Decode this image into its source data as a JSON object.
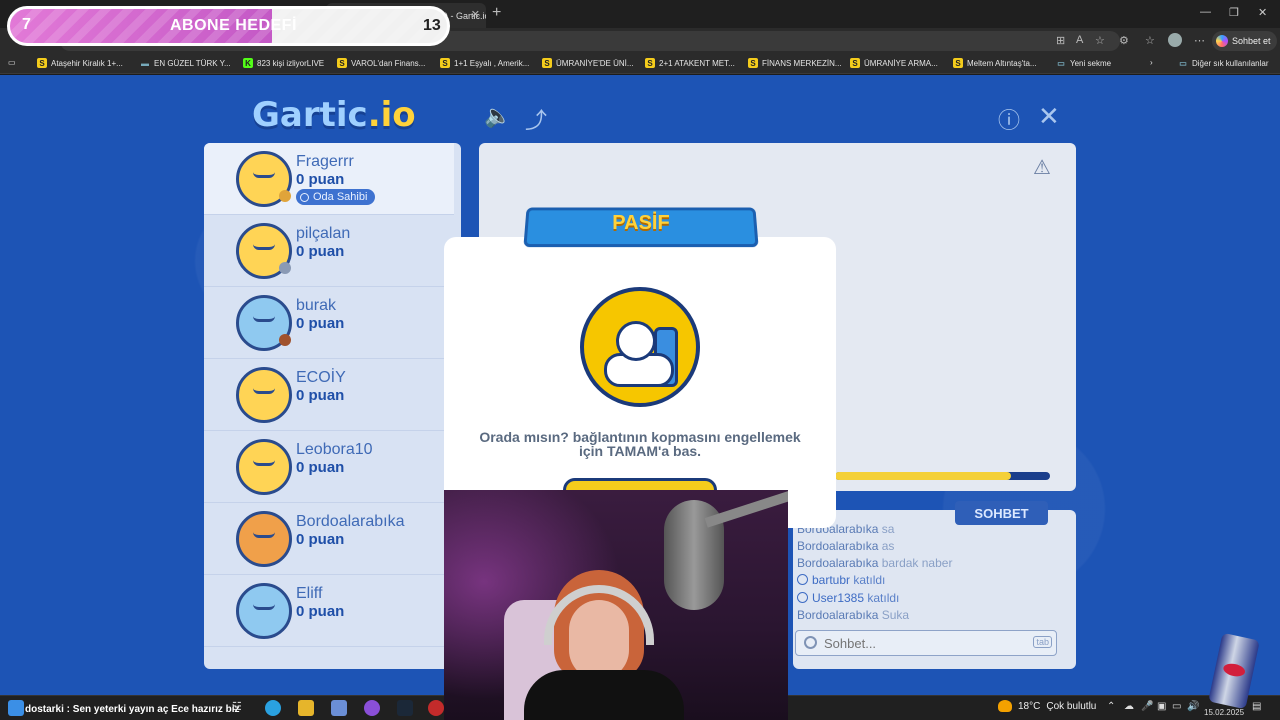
{
  "browser": {
    "tab_title": "Genel #5Ov2pQ (Türkçe) - Gartic.io",
    "sohbet_et": "Sohbet et",
    "bookmarks": [
      {
        "label": "Ataşehir Kiralık 1+...",
        "icon": "S"
      },
      {
        "label": "EN GÜZEL TÜRK Y...",
        "icon": "flag"
      },
      {
        "label": "823 kişi izliyorLIVE",
        "icon": "K"
      },
      {
        "label": "VAROL'dan Finans...",
        "icon": "S"
      },
      {
        "label": "1+1 Eşyalı , Amerik...",
        "icon": "S"
      },
      {
        "label": "ÜMRANİYE'DE ÜNİ...",
        "icon": "S"
      },
      {
        "label": "2+1 ATAKENT MET...",
        "icon": "S"
      },
      {
        "label": "FİNANS MERKEZİN...",
        "icon": "S"
      },
      {
        "label": "ÜMRANİYE ARMA...",
        "icon": "S"
      },
      {
        "label": "Meltem Altıntaş'ta...",
        "icon": "S"
      },
      {
        "label": "Yeni sekme",
        "icon": "page"
      }
    ],
    "other_bookmarks": "Diğer sık kullanılanlar"
  },
  "goal": {
    "current": "7",
    "title": "ABONE HEDEFİ",
    "target": "13",
    "progress_fraction": 0.538
  },
  "game": {
    "logo_main": "Gartic",
    "logo_suffix": ".io",
    "players": [
      {
        "name": "Fragerrr",
        "score": "0 puan",
        "owner_badge": "Oda Sahibi"
      },
      {
        "name": "pilçalan",
        "score": "0 puan"
      },
      {
        "name": "burak",
        "score": "0 puan"
      },
      {
        "name": "ECOİY",
        "score": "0 puan"
      },
      {
        "name": "Leobora10",
        "score": "0 puan"
      },
      {
        "name": "Bordoalarabıka",
        "score": "0 puan"
      },
      {
        "name": "Eliff",
        "score": "0 puan"
      }
    ],
    "timer_fraction": 0.82,
    "chat": {
      "tab_label": "SOHBET",
      "messages": [
        {
          "user": "Bordoalarabıka",
          "text": "sa"
        },
        {
          "user": "Bordoalarabıka",
          "text": "as"
        },
        {
          "user": "Bordoalarabıka",
          "text": "bardak naber"
        },
        {
          "join_user": "bartubr",
          "join_text": "katıldı"
        },
        {
          "join_user": "User1385",
          "join_text": "katıldı"
        },
        {
          "user": "Bordoalarabıka",
          "text": "Suka"
        }
      ],
      "input_placeholder": "Sohbet...",
      "tab_hint": "tab"
    }
  },
  "modal": {
    "title": "PASİF",
    "message": "Orada mısın? bağlantının kopmasını engellemek için TAMAM'a bas."
  },
  "taskbar": {
    "ticker_user": "dostarki",
    "ticker_text": " : Sen yeterki yayın aç Ece hazırız biz",
    "weather_temp": "18°C",
    "weather_desc": "Çok bulutlu",
    "date": "15.02.2025"
  },
  "colors": {
    "game_bg": "#1d54b5",
    "accent_yellow": "#f4cc1c",
    "goal_pink": "#e279d7"
  }
}
